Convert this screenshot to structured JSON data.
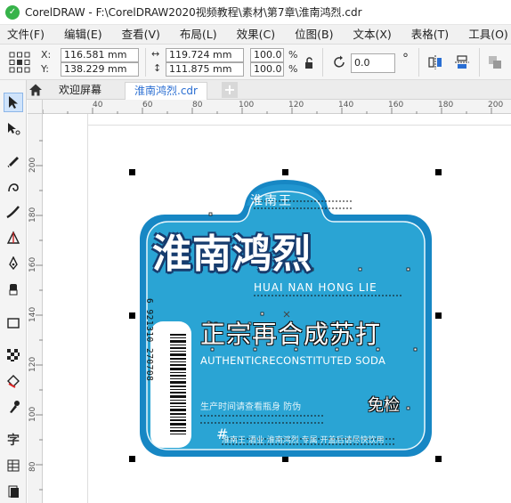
{
  "window": {
    "title": "CorelDRAW - F:\\CorelDRAW2020视频教程\\素材\\第7章\\淮南鸿烈.cdr"
  },
  "menu": {
    "items": [
      {
        "label": "文件(F)"
      },
      {
        "label": "编辑(E)"
      },
      {
        "label": "查看(V)"
      },
      {
        "label": "布局(L)"
      },
      {
        "label": "效果(C)"
      },
      {
        "label": "位图(B)"
      },
      {
        "label": "文本(X)"
      },
      {
        "label": "表格(T)"
      },
      {
        "label": "工具(O)"
      }
    ]
  },
  "property_bar": {
    "x_label": "X:",
    "y_label": "Y:",
    "x_value": "116.581 mm",
    "y_value": "138.229 mm",
    "width_value": "119.724 mm",
    "height_value": "111.875 mm",
    "scale_x": "100.0",
    "scale_y": "100.0",
    "percent": "%",
    "rotation": "0.0",
    "degree": "°"
  },
  "tabs": {
    "welcome": "欢迎屏幕",
    "document": "淮南鸿烈.cdr",
    "add": "+"
  },
  "ruler": {
    "h_ticks": [
      "40",
      "60",
      "80",
      "100",
      "120",
      "140",
      "160",
      "180",
      "200"
    ],
    "v_ticks": [
      "200",
      "180",
      "160",
      "140",
      "120",
      "100",
      "80"
    ]
  },
  "artwork": {
    "brand_small": "淮南王",
    "main_title": "淮南鸿烈",
    "pinyin": "HUAI NAN HONG LIE",
    "slogan": "正宗再合成苏打",
    "slogan_en": "AUTHENTICRECONSTITUTED SODA",
    "badge_free": "免检",
    "fine_print_1": "生产时间请查看瓶身 防伪",
    "fine_print_2": "淮南王 酒业 淮南鸿烈 专属 开盖后请尽快饮用",
    "hash": "#",
    "barcode_number": "6 921310 270708",
    "colors": {
      "body": "#2aa4d4",
      "frame": "#1787c4",
      "cap": "#1a93cf",
      "outline": "#173c6e"
    }
  },
  "toolbox": {
    "tools": [
      {
        "icon": "pick-tool-icon"
      },
      {
        "icon": "shape-tool-icon"
      },
      {
        "icon": "freehand-tool-icon"
      },
      {
        "icon": "curve-tool-icon"
      },
      {
        "icon": "artistic-media-icon"
      },
      {
        "icon": "crop-tool-icon"
      },
      {
        "icon": "pen-tool-icon"
      },
      {
        "icon": "eraser-tool-icon"
      },
      {
        "icon": "rectangle-tool-icon"
      },
      {
        "icon": "pattern-tool-icon"
      },
      {
        "icon": "fill-tool-icon"
      },
      {
        "icon": "eyedropper-tool-icon"
      },
      {
        "icon": "text-tool-icon"
      },
      {
        "icon": "table-tool-icon"
      },
      {
        "icon": "page-tool-icon"
      }
    ],
    "text_tool_glyph": "字"
  }
}
